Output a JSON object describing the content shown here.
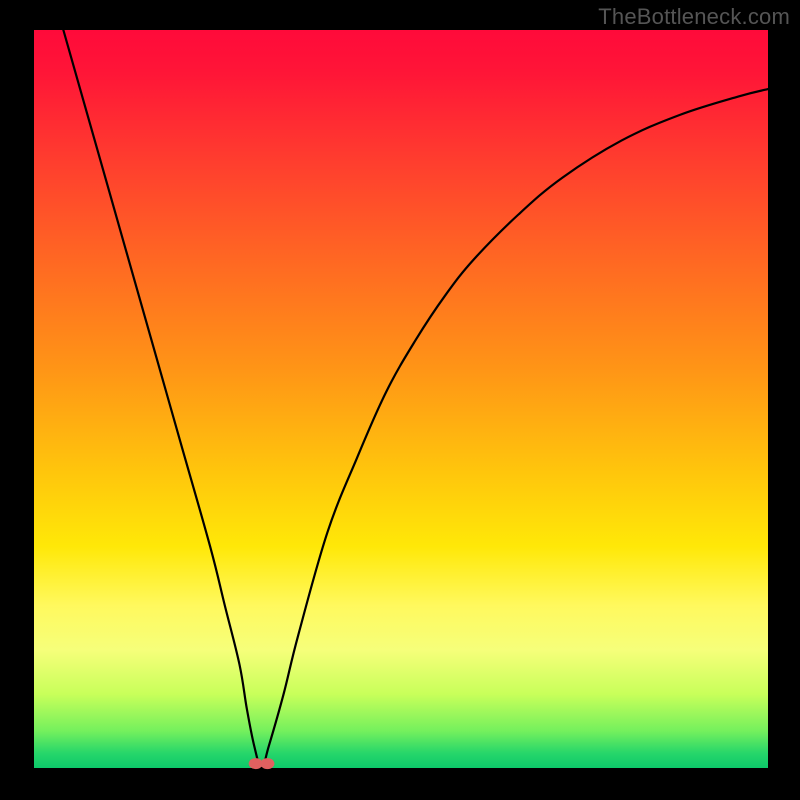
{
  "watermark": "TheBottleneck.com",
  "chart_data": {
    "type": "line",
    "title": "",
    "xlabel": "",
    "ylabel": "",
    "xlim": [
      0,
      100
    ],
    "ylim": [
      0,
      100
    ],
    "grid": false,
    "legend": false,
    "background_gradient": {
      "top": "#ff0a3a",
      "bottom": "#0dc96a",
      "meaning": "bottleneck severity (red = high, green = low)"
    },
    "series": [
      {
        "name": "bottleneck-curve",
        "x": [
          4,
          8,
          12,
          16,
          20,
          24,
          26,
          28,
          29,
          30,
          31,
          32,
          34,
          36,
          40,
          44,
          48,
          52,
          56,
          60,
          66,
          72,
          80,
          88,
          96,
          100
        ],
        "values": [
          100,
          86,
          72,
          58,
          44,
          30,
          22,
          14,
          8,
          3,
          0,
          3,
          10,
          18,
          32,
          42,
          51,
          58,
          64,
          69,
          75,
          80,
          85,
          88.5,
          91,
          92
        ],
        "minimum_at_x": 31,
        "minimum_value": 0
      }
    ],
    "markers": [
      {
        "name": "min-point-a",
        "x": 30.2,
        "y": 0.6,
        "color": "#e06060"
      },
      {
        "name": "min-point-b",
        "x": 31.8,
        "y": 0.6,
        "color": "#e06060"
      }
    ]
  }
}
